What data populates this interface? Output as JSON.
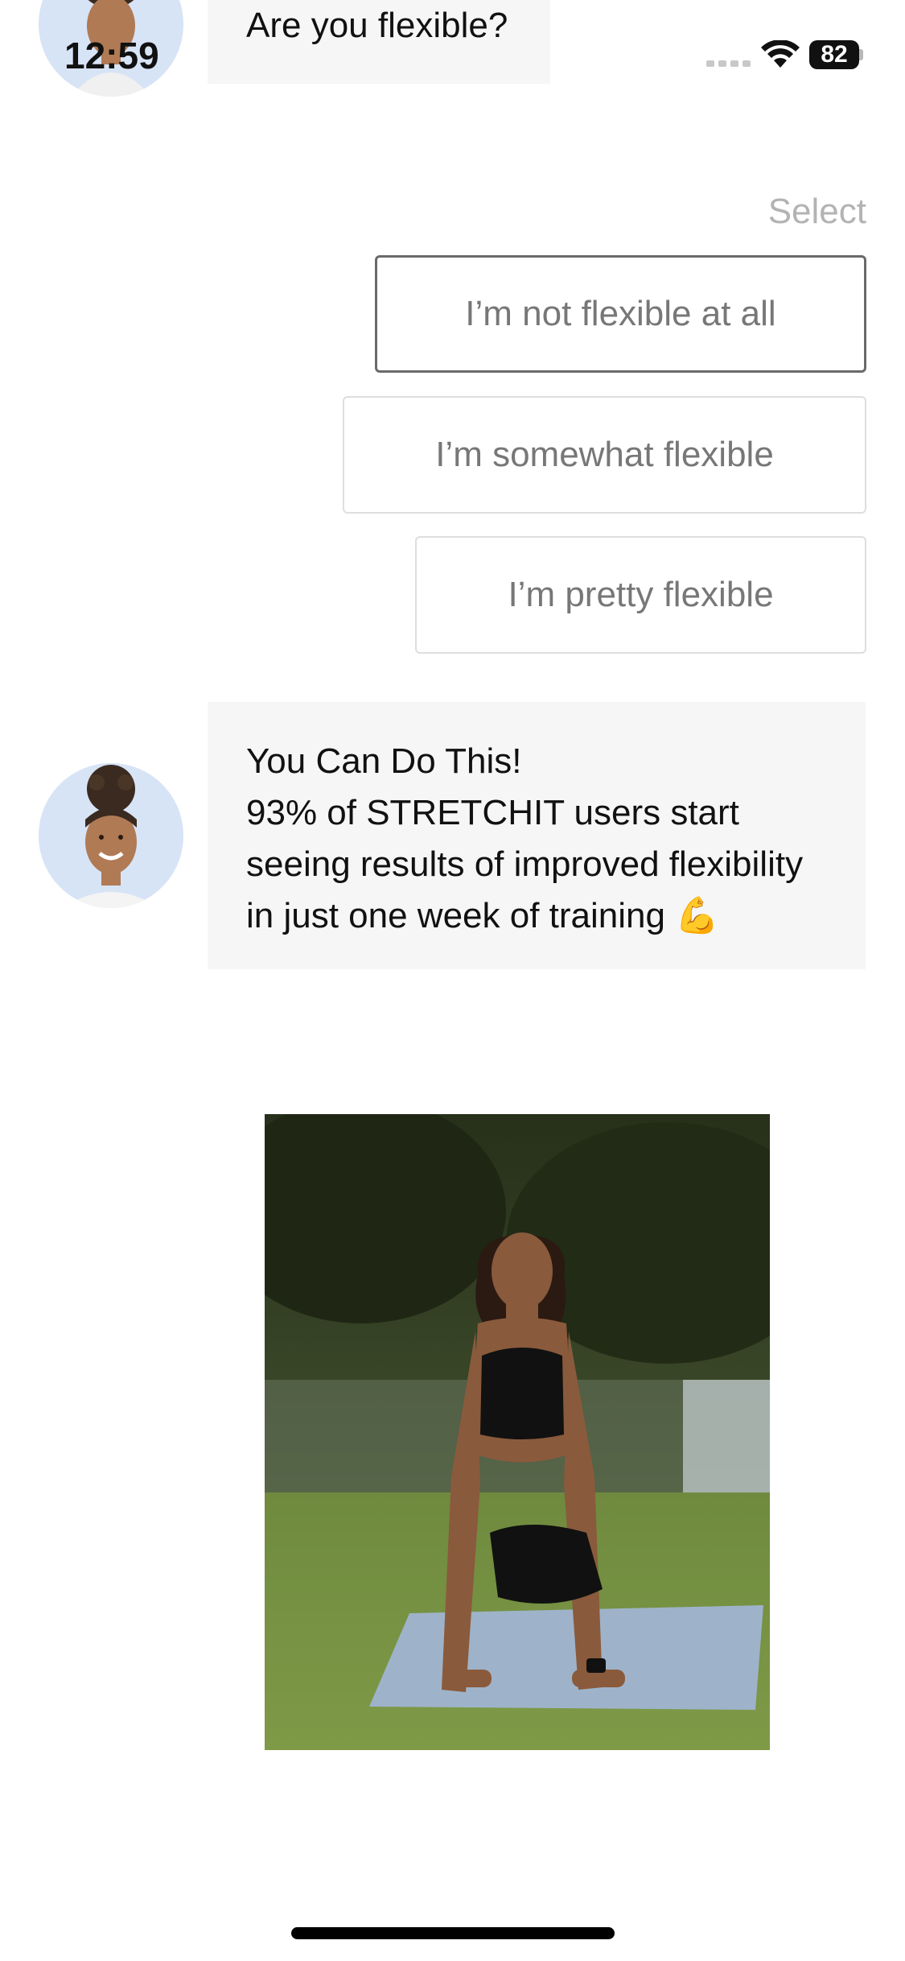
{
  "status_bar": {
    "time": "12:59",
    "battery": "82"
  },
  "chat": {
    "question": "Are you flexible?",
    "select_label": "Select",
    "options": [
      "I’m not flexible at all",
      "I’m somewhat flexible",
      "I’m pretty flexible"
    ],
    "encouragement": {
      "title": "You Can Do This!",
      "body": "93% of STRETCHIT users start seeing results of improved flexibility in just one week of training 💪"
    }
  },
  "colors": {
    "avatar_bg": "#d7e4f6",
    "bubble_bg": "#f6f6f6",
    "option_border": "#dedede",
    "option_active_border": "#6a6a6a",
    "option_text": "#777777",
    "select_text": "#b3b3b3"
  }
}
